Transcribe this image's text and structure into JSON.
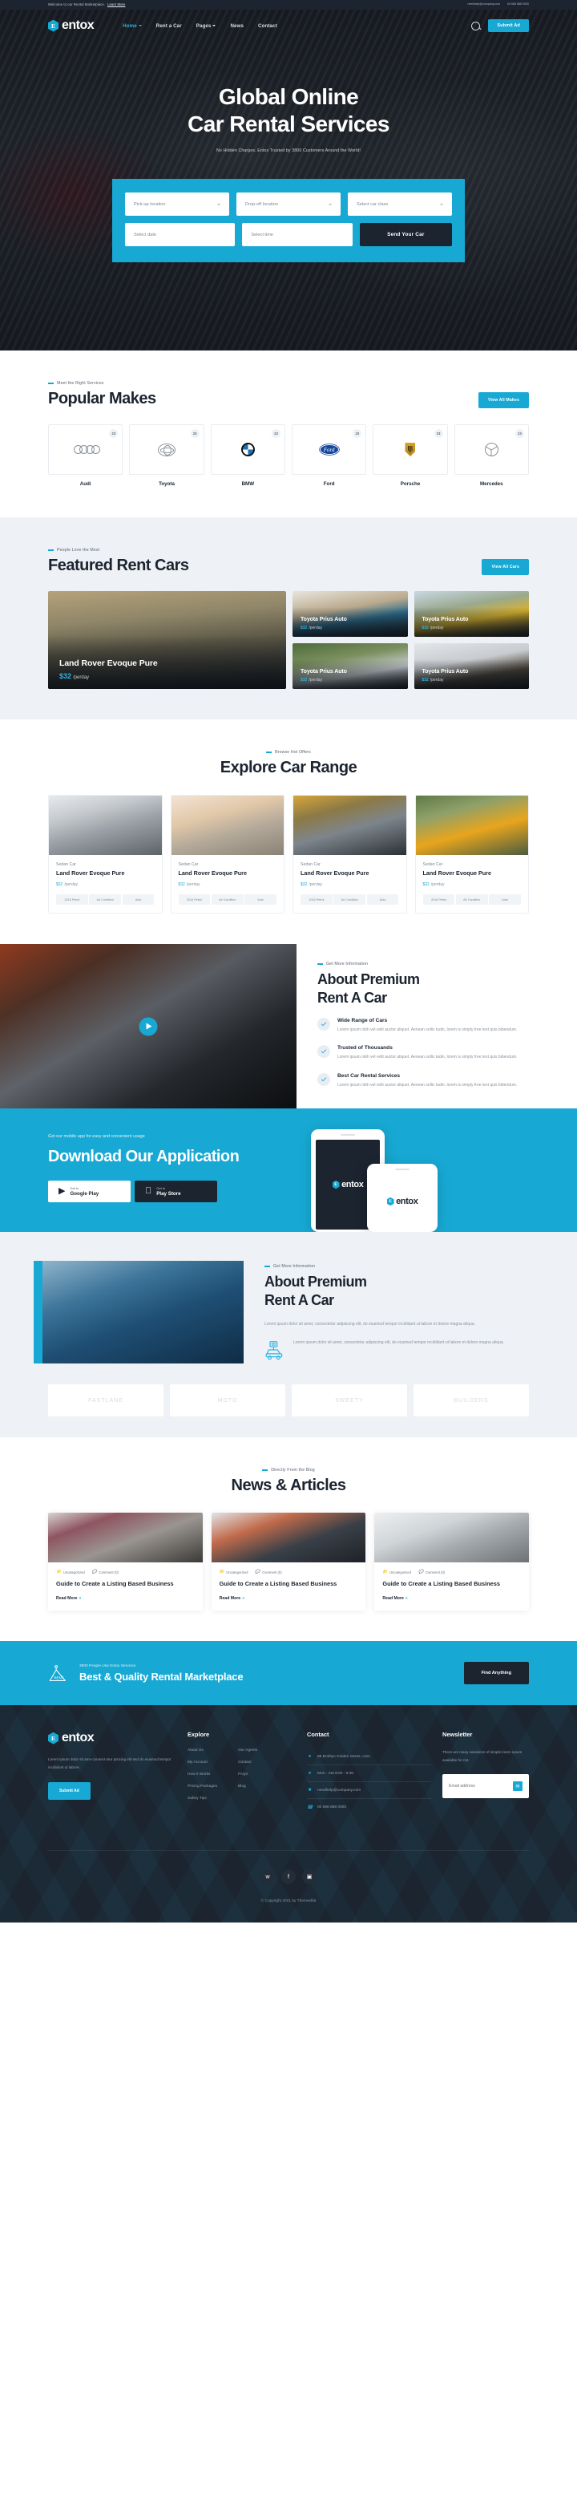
{
  "topbar": {
    "welcome": "Welcome to our Rental Marketplace.",
    "learn_more": "Learn More",
    "email": "needhelp@company.com",
    "phone": "00 666 888 0000"
  },
  "brand": {
    "mark": "E",
    "name": "entox"
  },
  "nav": {
    "items": [
      {
        "label": "Home",
        "caret": true,
        "active": true
      },
      {
        "label": "Rent a Car",
        "caret": false,
        "active": false
      },
      {
        "label": "Pages",
        "caret": true,
        "active": false
      },
      {
        "label": "News",
        "caret": false,
        "active": false
      },
      {
        "label": "Contact",
        "caret": false,
        "active": false
      }
    ],
    "search_icon": "search-icon",
    "cta": "Submit Ad"
  },
  "hero": {
    "title_line1": "Global Online",
    "title_line2": "Car Rental Services",
    "subtitle": "No Hidden Charges. Entox Trusted by 3800 Customers Around the World!",
    "form": {
      "pickup": "Pick-up location",
      "dropoff": "Drop-off location",
      "car_class": "Select car class",
      "date": "Select date",
      "time": "Select time",
      "submit": "Send Your Car"
    }
  },
  "makes": {
    "eyebrow": "Meet the Right Services",
    "title": "Popular Makes",
    "button": "View All Makes",
    "items": [
      {
        "name": "Audi",
        "count": "23",
        "glyph": "audi-logo-icon"
      },
      {
        "name": "Toyota",
        "count": "23",
        "glyph": "toyota-logo-icon"
      },
      {
        "name": "BMW",
        "count": "23",
        "glyph": "bmw-logo-icon"
      },
      {
        "name": "Ford",
        "count": "23",
        "glyph": "ford-logo-icon"
      },
      {
        "name": "Porsche",
        "count": "23",
        "glyph": "porsche-logo-icon"
      },
      {
        "name": "Mercedes",
        "count": "23",
        "glyph": "mercedes-logo-icon"
      }
    ]
  },
  "featured": {
    "eyebrow": "People Love the Most",
    "title": "Featured Rent Cars",
    "button": "View All Cars",
    "main": {
      "name": "Land Rover Evoque Pure",
      "price": "$32",
      "unit": "/perday"
    },
    "items": [
      {
        "name": "Toyota Prius Auto",
        "price": "$32",
        "unit": "/perday"
      },
      {
        "name": "Toyota Prius Auto",
        "price": "$32",
        "unit": "/perday"
      },
      {
        "name": "Toyota Prius Auto",
        "price": "$32",
        "unit": "/perday"
      },
      {
        "name": "Toyota Prius Auto",
        "price": "$32",
        "unit": "/perday"
      }
    ]
  },
  "range": {
    "eyebrow": "Browse Hot Offers",
    "title": "Explore Car Range",
    "items": [
      {
        "type": "Sedan Car",
        "name": "Land Rover Evoque Pure",
        "price": "$32",
        "unit": "/perday",
        "tags": [
          "2016 Petrol",
          "Air Condition",
          "Auto"
        ]
      },
      {
        "type": "Sedan Car",
        "name": "Land Rover Evoque Pure",
        "price": "$32",
        "unit": "/perday",
        "tags": [
          "2016 Petrol",
          "Air Condition",
          "Auto"
        ]
      },
      {
        "type": "Sedan Car",
        "name": "Land Rover Evoque Pure",
        "price": "$32",
        "unit": "/perday",
        "tags": [
          "2016 Petrol",
          "Air Condition",
          "Auto"
        ]
      },
      {
        "type": "Sedan Car",
        "name": "Land Rover Evoque Pure",
        "price": "$32",
        "unit": "/perday",
        "tags": [
          "2016 Petrol",
          "Air Condition",
          "Auto"
        ]
      }
    ]
  },
  "about1": {
    "eyebrow": "Get More Information",
    "title_line1": "About Premium",
    "title_line2": "Rent A Car",
    "features": [
      {
        "title": "Wide Range of Cars",
        "text": "Lorem ipsum nibh vel velit auctor aliquet. Aenean sollic tudin, lorem is simply free text quis bibendum."
      },
      {
        "title": "Trusted of Thousands",
        "text": "Lorem ipsum nibh vel velit auctor aliquet. Aenean sollic tudin, lorem is simply free text quis bibendum."
      },
      {
        "title": "Best Car Rental Services",
        "text": "Lorem ipsum nibh vel velit auctor aliquet. Aenean sollic tudin, lorem is simply free text quis bibendum."
      }
    ]
  },
  "app": {
    "kicker": "Get our mobile app for easy and convenient usage",
    "title": "Download Our Application",
    "buttons": [
      {
        "small": "Get In",
        "big": "Google Play",
        "icon": "play-triangle-icon"
      },
      {
        "small": "Get In",
        "big": "Play Store",
        "icon": "apple-icon"
      }
    ]
  },
  "about2": {
    "eyebrow": "Get More Information",
    "title_line1": "About Premium",
    "title_line2": "Rent A Car",
    "paragraph": "Lorem ipsum dolor sit amet, consectetur adipiscing elit, do  eiusmod tempor incididunt ut labore et dolore magna aliqua.",
    "feature_text": "Lorem ipsum dolor sit amet, consectetur adipiscing elit, do  eiusmod tempor incididunt ut labore et dolore magna aliqua."
  },
  "brands": [
    {
      "name": "FASTLANE"
    },
    {
      "name": "MOTO"
    },
    {
      "name": "SWEETY"
    },
    {
      "name": "BUILDERS"
    }
  ],
  "news": {
    "eyebrow": "Directly From the Blog",
    "title": "News & Articles",
    "items": [
      {
        "category": "Uncategorized",
        "comments": "Comment (0)",
        "title": "Guide to Create a Listing Based Business",
        "more": "Read More"
      },
      {
        "category": "Uncategorized",
        "comments": "Comment (0)",
        "title": "Guide to Create a Listing Based Business",
        "more": "Read More"
      },
      {
        "category": "Uncategorized",
        "comments": "Comment (0)",
        "title": "Guide to Create a Listing Based Business",
        "more": "Read More"
      }
    ]
  },
  "cta": {
    "kicker": "3800 People Use Entox Services",
    "title": "Best & Quality Rental Marketplace",
    "button": "Find Anything",
    "tag_label": "RENT"
  },
  "footer": {
    "about_text": "Lorem ipsum dolor sit ame consect etur pisicing elit sed do eiusmod tempor incididunt ut labore.",
    "submit_button": "Submit Ad",
    "explore": {
      "heading": "Explore",
      "col1": [
        "About Us",
        "My Account",
        "How It Works",
        "Pricing Packages",
        "Safety Tips"
      ],
      "col2": [
        "Our Agents",
        "Contact",
        "FAQs",
        "Blog"
      ]
    },
    "contact": {
      "heading": "Contact",
      "items": [
        {
          "icon": "location-pin-icon",
          "text": "88 Broklyn Golden Street, USA"
        },
        {
          "icon": "clock-icon",
          "text": "Mon - Sat 8:00 - 6:30"
        },
        {
          "icon": "envelope-icon",
          "text": "needhelp@company.com"
        },
        {
          "icon": "phone-icon",
          "text": "00 666 888 0000"
        }
      ]
    },
    "newsletter": {
      "heading": "Newsletter",
      "text": "There are many variations of simple lorem ipsum available for not.",
      "placeholder": "Email address",
      "send_icon": "send-icon"
    },
    "social": [
      {
        "icon": "twitter-icon",
        "glyph": "🐦"
      },
      {
        "icon": "facebook-icon",
        "glyph": "f"
      },
      {
        "icon": "instagram-icon",
        "glyph": "▣"
      }
    ],
    "copyright": "© Copyright 2021 by Themesflat"
  },
  "colors": {
    "accent": "#17a9d4",
    "dark": "#1b242f",
    "light_bg": "#eef1f5"
  }
}
